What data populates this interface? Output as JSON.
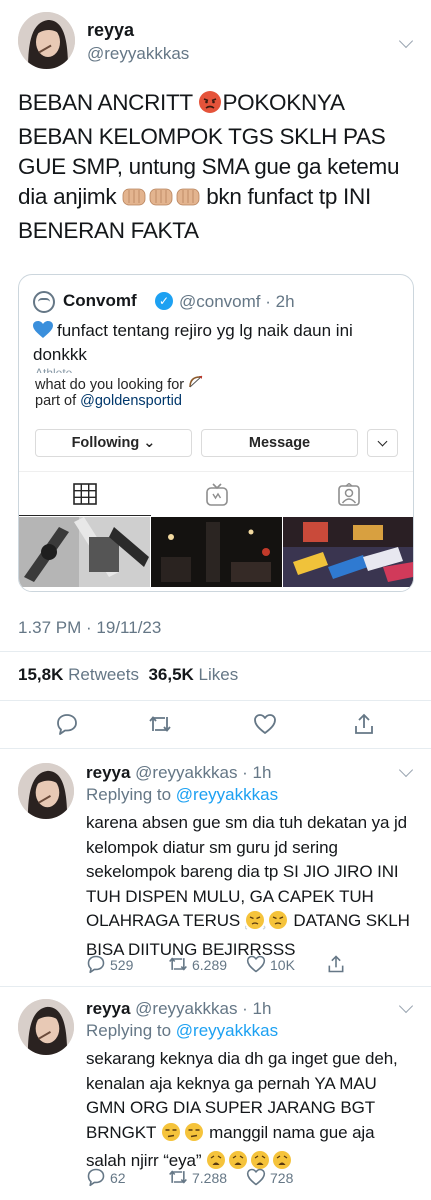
{
  "main_tweet": {
    "display_name": "reyya",
    "handle": "@reyyakkkas",
    "text_part1": "BEBAN ANCRITT ",
    "text_part2": "POKOKNYA BEBAN KELOMPOK TGS SKLH PAS GUE SMP, untung SMA gue ga ketemu dia anjimk ",
    "text_part3": " bkn funfact tp INI BENERAN FAKTA",
    "timestamp": "1.37 PM · 19/11/23",
    "retweets_count": "15,8K",
    "retweets_label": "Retweets",
    "likes_count": "36,5K",
    "likes_label": "Likes"
  },
  "quoted_tweet": {
    "display_name": "Convomf",
    "handle": "@convomf · 2h",
    "text": "funfact tentang rejiro yg lg naik daun ini donkkk",
    "screenshot": {
      "cut_label": "Athlete",
      "bio_line1": "what do you looking for ",
      "bio_line2_prefix": "part of ",
      "bio_line2_tag": "@goldensportid",
      "following_label": "Following",
      "message_label": "Message"
    }
  },
  "replies": [
    {
      "display_name": "reyya",
      "handle": "@reyyakkkas · 1h",
      "replying_prefix": "Replying to ",
      "replying_to": "@reyyakkkas",
      "text_part1": "karena absen gue sm dia tuh dekatan ya jd kelompok diatur sm guru jd sering sekelompok bareng dia tp SI JIO JIRO INI TUH DISPEN MULU, GA CAPEK TUH OLAHRAGA TERUS ",
      "text_part2": " DATANG SKLH BISA DIITUNG BEJIRRSSS",
      "reply_count": "529",
      "retweet_count": "6.289",
      "like_count": "10K"
    },
    {
      "display_name": "reyya",
      "handle": "@reyyakkkas · 1h",
      "replying_prefix": "Replying to ",
      "replying_to": "@reyyakkkas",
      "text_part1": "sekarang keknya dia dh ga inget gue deh, kenalan aja keknya ga pernah YA MAU GMN ORG DIA SUPER JARANG BGT BRNGKT ",
      "text_part2": " manggil nama gue aja salah njirr “eya” ",
      "reply_count": "62",
      "retweet_count": "7.288",
      "like_count": "728"
    }
  ],
  "colors": {
    "accent": "#1da1f2",
    "text_primary": "#14171a",
    "text_secondary": "#657786",
    "divider": "#e6ecf0"
  },
  "icons": [
    "reply-icon",
    "retweet-icon",
    "like-icon",
    "share-icon",
    "verified-icon",
    "chevron-down-icon",
    "grid-icon",
    "igtv-icon",
    "tagged-icon",
    "blue-heart-icon",
    "angry-face-emoji",
    "clapping-hands-emoji",
    "huffing-face-emoji",
    "unamused-face-emoji",
    "weary-face-emoji",
    "bow-arrow-emoji"
  ]
}
